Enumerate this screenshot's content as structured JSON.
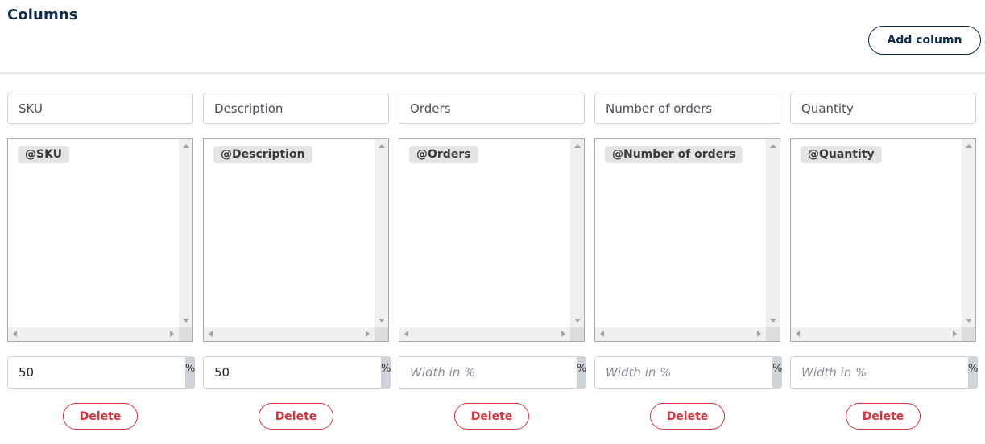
{
  "header": {
    "title": "Columns",
    "add_label": "Add column"
  },
  "columns": [
    {
      "name": "SKU",
      "tag": "@SKU",
      "width_value": "50",
      "width_placeholder": "Width in %",
      "unit": "%",
      "delete_label": "Delete"
    },
    {
      "name": "Description",
      "tag": "@Description",
      "width_value": "50",
      "width_placeholder": "Width in %",
      "unit": "%",
      "delete_label": "Delete"
    },
    {
      "name": "Orders",
      "tag": "@Orders",
      "width_value": "",
      "width_placeholder": "Width in %",
      "unit": "%",
      "delete_label": "Delete"
    },
    {
      "name": "Number of orders",
      "tag": "@Number of orders",
      "width_value": "",
      "width_placeholder": "Width in %",
      "unit": "%",
      "delete_label": "Delete"
    },
    {
      "name": "Quantity",
      "tag": "@Quantity",
      "width_value": "",
      "width_placeholder": "Width in %",
      "unit": "%",
      "delete_label": "Delete"
    }
  ],
  "colors": {
    "title": "#0f2a4a",
    "delete": "#d9333f",
    "tag_bg": "#e4e4e4",
    "addon_bg": "#ced4da"
  }
}
